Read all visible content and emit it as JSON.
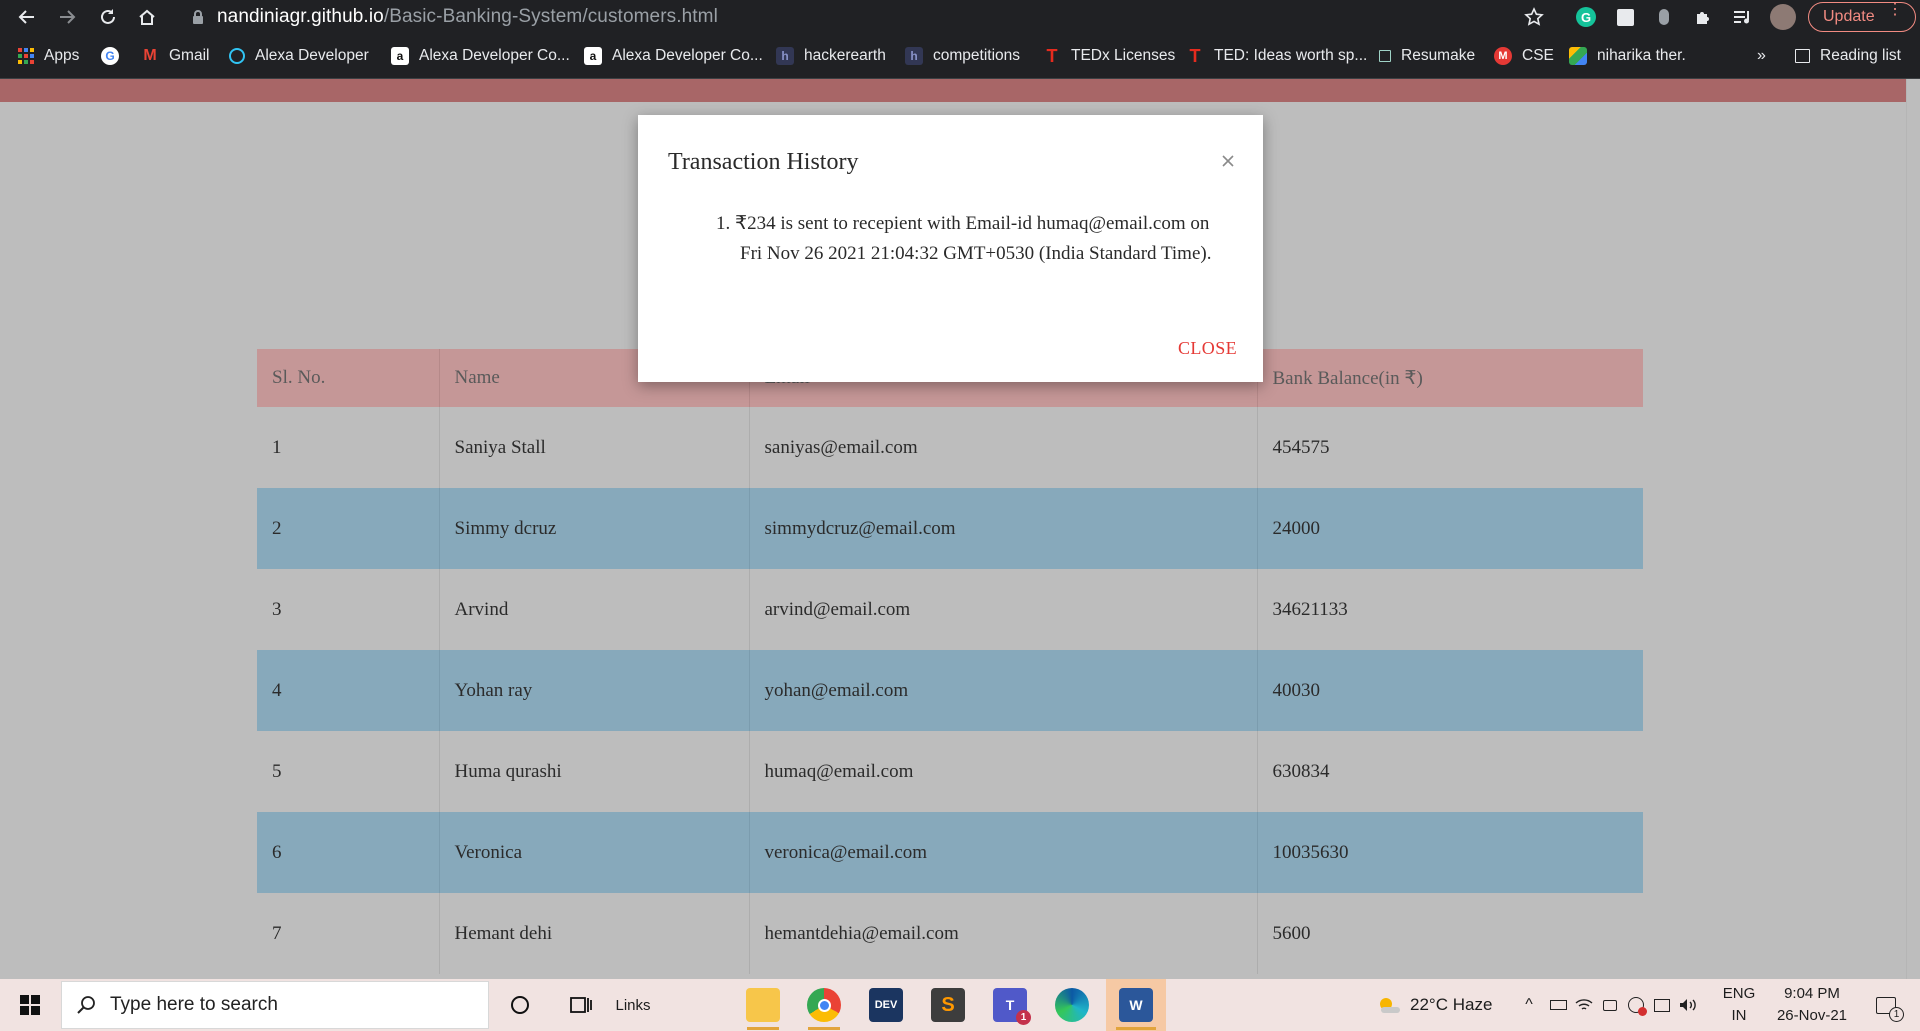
{
  "browser": {
    "url_host": "nandiniagr.github.io",
    "url_path": "/Basic-Banking-System/customers.html",
    "update_label": "Update",
    "bookmarks": [
      {
        "label": "Apps",
        "icon": "apps-grid-icon"
      },
      {
        "label": "",
        "icon": "google-icon"
      },
      {
        "label": "Gmail",
        "icon": "gmail-icon"
      },
      {
        "label": "Alexa Developer",
        "icon": "alexa-icon"
      },
      {
        "label": "Alexa Developer Co...",
        "icon": "amazon-icon"
      },
      {
        "label": "Alexa Developer Co...",
        "icon": "amazon-icon"
      },
      {
        "label": "hackerearth",
        "icon": "hackerearth-icon"
      },
      {
        "label": "competitions",
        "icon": "hackerearth-icon"
      },
      {
        "label": "TEDx Licenses",
        "icon": "ted-icon"
      },
      {
        "label": "TED: Ideas worth sp...",
        "icon": "ted-icon"
      },
      {
        "label": "Resumake",
        "icon": "resumake-icon"
      },
      {
        "label": "CSE",
        "icon": "cse-icon"
      },
      {
        "label": "niharika ther.",
        "icon": "drive-icon"
      }
    ],
    "more_label": "»",
    "reading_list_label": "Reading list"
  },
  "table": {
    "headers": [
      "Sl. No.",
      "Name",
      "Email",
      "Bank Balance(in ₹)"
    ],
    "rows": [
      [
        "1",
        "Saniya Stall",
        "saniyas@email.com",
        "454575"
      ],
      [
        "2",
        "Simmy dcruz",
        "simmydcruz@email.com",
        "24000"
      ],
      [
        "3",
        "Arvind",
        "arvind@email.com",
        "34621133"
      ],
      [
        "4",
        "Yohan ray",
        "yohan@email.com",
        "40030"
      ],
      [
        "5",
        "Huma qurashi",
        "humaq@email.com",
        "630834"
      ],
      [
        "6",
        "Veronica",
        "veronica@email.com",
        "10035630"
      ],
      [
        "7",
        "Hemant dehi",
        "hemantdehia@email.com",
        "5600"
      ]
    ]
  },
  "modal": {
    "title": "Transaction History",
    "items": [
      "1. ₹234 is sent to recepient with Email-id humaq@email.com on Fri Nov 26 2021 21:04:32 GMT+0530 (India Standard Time)."
    ],
    "close_label": "CLOSE"
  },
  "taskbar": {
    "search_placeholder": "Type here to search",
    "links_label": "Links",
    "weather": "22°C  Haze",
    "lang_top": "ENG",
    "lang_bottom": "IN",
    "time": "9:04 PM",
    "date": "26-Nov-21",
    "notification_count": "1",
    "teams_badge": "1"
  },
  "colors": {
    "header_row": "#c59797",
    "stripe_row": "#87a9bb",
    "close_button": "#e53935",
    "update_button": "#f28b82"
  }
}
